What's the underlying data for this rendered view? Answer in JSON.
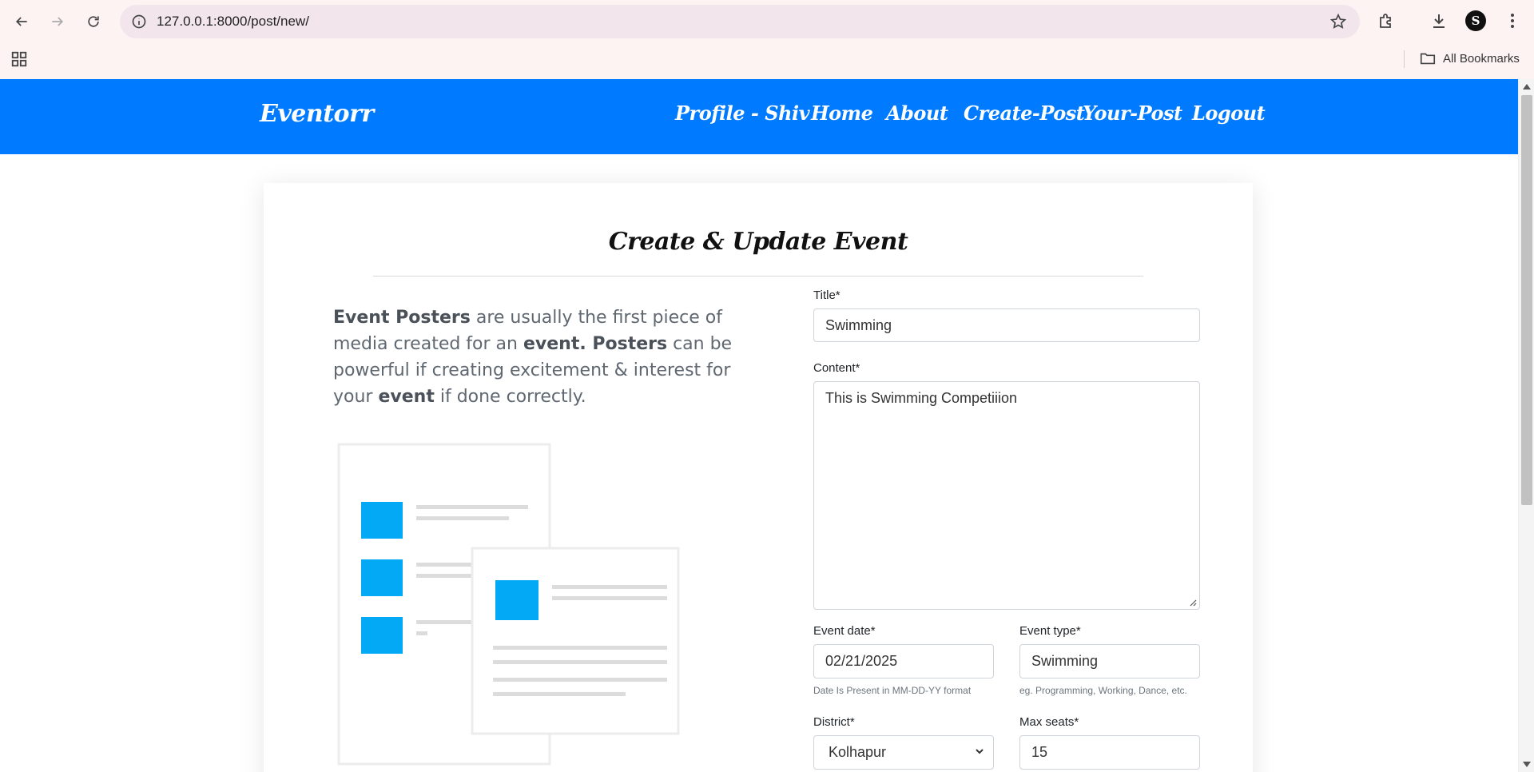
{
  "browser": {
    "url": "127.0.0.1:8000/post/new/",
    "profile_initial": "S",
    "bookmarks_label": "All Bookmarks"
  },
  "site": {
    "brand": "Eventorr",
    "menu": [
      "Profile - Shiv",
      "Home",
      "About",
      "Create-Post",
      "Your-Post",
      "Logout"
    ],
    "brand_color": "#007bff"
  },
  "card": {
    "title": "Create & Update Event",
    "intro": {
      "p1": "Event Posters",
      "p2": " are usually the first piece of media created for an ",
      "p3": "event. Posters",
      "p4": " can be powerful if creating excitement & interest for your ",
      "p5": "event",
      "p6": " if done correctly."
    }
  },
  "form": {
    "title_label": "Title*",
    "title_value": "Swimming",
    "content_label": "Content*",
    "content_value": "This is Swimming Competiiion",
    "event_date_label": "Event date*",
    "event_date_value": "02/21/2025",
    "event_date_hint": "Date Is Present in MM-DD-YY format",
    "event_type_label": "Event type*",
    "event_type_value": "Swimming",
    "event_type_hint": "eg. Programming, Working, Dance, etc.",
    "district_label": "District*",
    "district_value": "Kolhapur",
    "max_seats_label": "Max seats*",
    "max_seats_value": "15"
  },
  "icons": {
    "back": "arrow-left-icon",
    "forward": "arrow-right-icon",
    "reload": "reload-icon",
    "info": "info-icon",
    "star": "star-icon",
    "extensions": "puzzle-icon",
    "download": "download-icon",
    "menu": "kebab-menu-icon",
    "apps": "apps-grid-icon",
    "folder": "folder-icon"
  },
  "colors": {
    "accent_blue": "#007bff",
    "illustration_blue": "#03a9f4"
  }
}
